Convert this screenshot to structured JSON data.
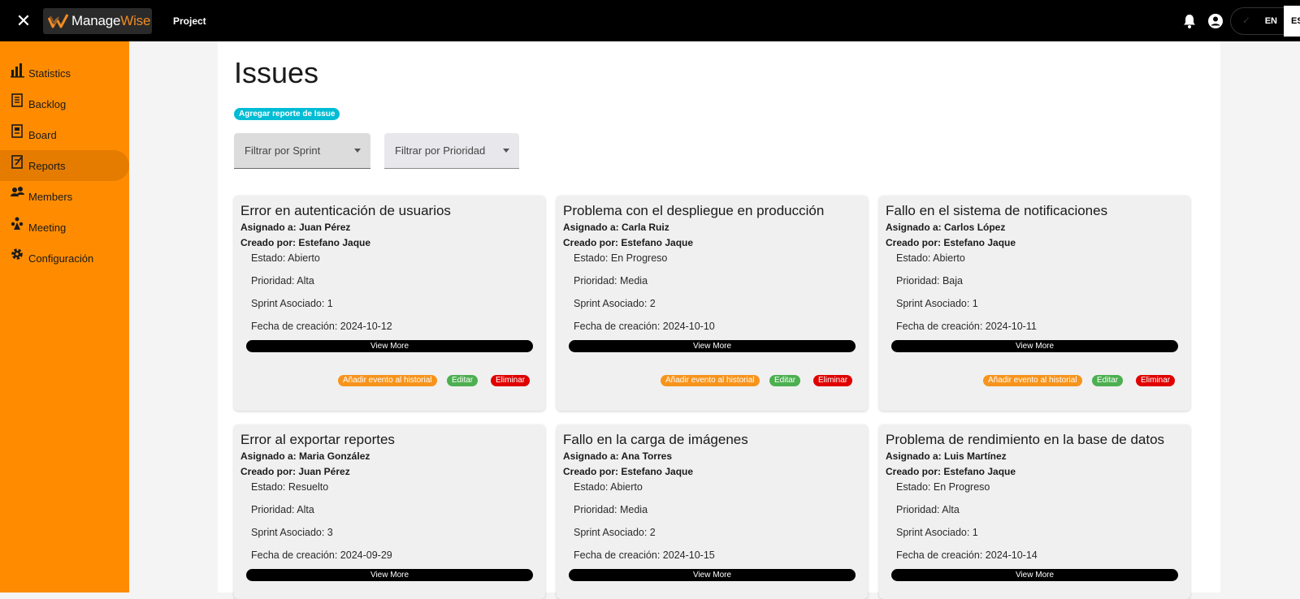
{
  "app": {
    "logo_text_a": "Manage",
    "logo_text_b": "Wise",
    "project_label": "Project",
    "lang_active": "EN",
    "lang_other": "ES"
  },
  "sidebar": {
    "items": [
      {
        "label": "Statistics",
        "icon": "bar-chart-icon"
      },
      {
        "label": "Backlog",
        "icon": "backlog-icon"
      },
      {
        "label": "Board",
        "icon": "board-icon"
      },
      {
        "label": "Reports",
        "icon": "reports-icon",
        "active": true
      },
      {
        "label": "Members",
        "icon": "members-icon"
      },
      {
        "label": "Meeting",
        "icon": "meeting-icon"
      },
      {
        "label": "Configuración",
        "icon": "gear-icon"
      }
    ]
  },
  "page": {
    "title": "Issues",
    "add_button": "Agregar reporte de Issue",
    "filter_sprint": "Filtrar por Sprint",
    "filter_priority": "Filtrar por Prioridad"
  },
  "labels": {
    "assigned": "Asignado a:",
    "created_by": "Creado por:",
    "status": "Estado:",
    "priority": "Prioridad:",
    "sprint": "Sprint Asociado:",
    "created_date": "Fecha de creación:",
    "view_more": "View More",
    "add_event": "Añadir evento al historial",
    "edit": "Editar",
    "delete": "Eliminar"
  },
  "issues": [
    {
      "title": "Error en autenticación de usuarios",
      "assigned": "Asignado a: Juan Pérez",
      "created_by": "Creado por: Estefano Jaque",
      "status": "Estado: Abierto",
      "priority": "Prioridad: Alta",
      "sprint": "Sprint Asociado: 1",
      "date": "Fecha de creación: 2024-10-12"
    },
    {
      "title": "Problema con el despliegue en producción",
      "assigned": "Asignado a: Carla Ruiz",
      "created_by": "Creado por: Estefano Jaque",
      "status": "Estado: En Progreso",
      "priority": "Prioridad: Media",
      "sprint": "Sprint Asociado: 2",
      "date": "Fecha de creación: 2024-10-10"
    },
    {
      "title": "Fallo en el sistema de notificaciones",
      "assigned": "Asignado a: Carlos López",
      "created_by": "Creado por: Estefano Jaque",
      "status": "Estado: Abierto",
      "priority": "Prioridad: Baja",
      "sprint": "Sprint Asociado: 1",
      "date": "Fecha de creación: 2024-10-11"
    },
    {
      "title": "Error al exportar reportes",
      "assigned": "Asignado a: Maria González",
      "created_by": "Creado por: Juan Pérez",
      "status": "Estado: Resuelto",
      "priority": "Prioridad: Alta",
      "sprint": "Sprint Asociado: 3",
      "date": "Fecha de creación: 2024-09-29"
    },
    {
      "title": "Fallo en la carga de imágenes",
      "assigned": "Asignado a: Ana Torres",
      "created_by": "Creado por: Estefano Jaque",
      "status": "Estado: Abierto",
      "priority": "Prioridad: Media",
      "sprint": "Sprint Asociado: 2",
      "date": "Fecha de creación: 2024-10-15"
    },
    {
      "title": "Problema de rendimiento en la base de datos",
      "assigned": "Asignado a: Luis Martínez",
      "created_by": "Creado por: Estefano Jaque",
      "status": "Estado: En Progreso",
      "priority": "Prioridad: Alta",
      "sprint": "Sprint Asociado: 1",
      "date": "Fecha de creación: 2024-10-14"
    }
  ],
  "colors": {
    "sidebar": "#ff8c00",
    "sidebar_active": "#e57c00",
    "accent_cyan": "#00bcd4",
    "history_chip": "#f7941d",
    "edit_chip": "#4caf50",
    "delete_chip": "#e00000"
  }
}
